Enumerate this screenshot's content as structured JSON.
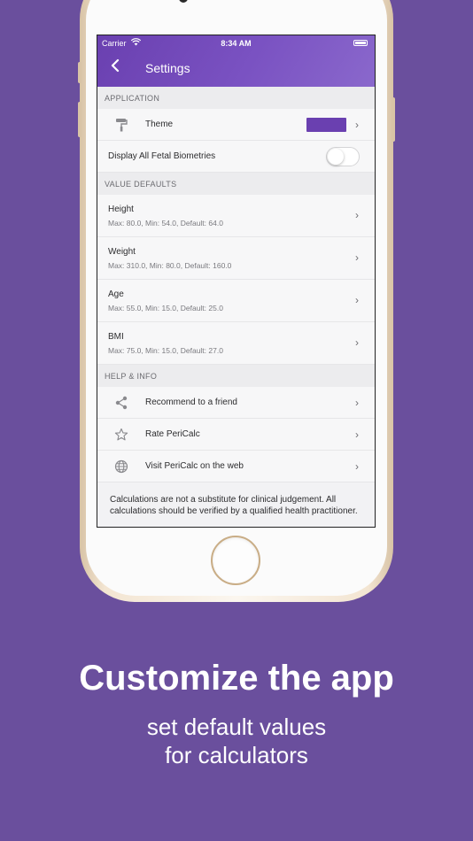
{
  "status": {
    "carrier": "Carrier",
    "time": "8:34 AM"
  },
  "nav": {
    "title": "Settings"
  },
  "application": {
    "header": "APPLICATION",
    "theme_label": "Theme",
    "theme_color": "#6a40b0",
    "biometries_label": "Display All Fetal Biometries",
    "biometries_on": false
  },
  "value_defaults": {
    "header": "VALUE DEFAULTS",
    "items": [
      {
        "title": "Height",
        "detail": "Max: 80.0, Min: 54.0, Default: 64.0"
      },
      {
        "title": "Weight",
        "detail": "Max: 310.0, Min: 80.0, Default: 160.0"
      },
      {
        "title": "Age",
        "detail": "Max: 55.0, Min: 15.0, Default: 25.0"
      },
      {
        "title": "BMI",
        "detail": "Max: 75.0, Min: 15.0, Default: 27.0"
      }
    ]
  },
  "help": {
    "header": "HELP & INFO",
    "items": [
      {
        "label": "Recommend to a friend",
        "icon": "share-icon"
      },
      {
        "label": "Rate PeriCalc",
        "icon": "star-icon"
      },
      {
        "label": "Visit PeriCalc on the web",
        "icon": "globe-icon"
      }
    ]
  },
  "disclaimer": "Calculations are not a substitute for clinical judgement. All calculations should be verified by a qualified health practitioner.",
  "marketing": {
    "headline": "Customize the app",
    "sub_line1": "set default values",
    "sub_line2": "for calculators"
  }
}
